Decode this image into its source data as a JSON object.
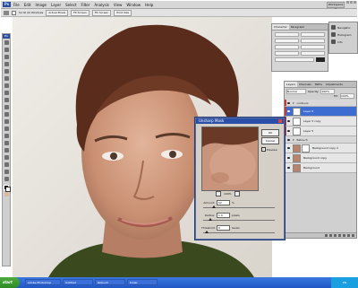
{
  "menubar": {
    "app": "Ps",
    "items": [
      "File",
      "Edit",
      "Image",
      "Layer",
      "Select",
      "Filter",
      "Analysis",
      "View",
      "Window",
      "Help"
    ],
    "workspace": "Workspace ▾"
  },
  "options": {
    "scroll_all": "Scroll All Windows",
    "actual_pixels": "Actual Pixels",
    "fit_screen": "Fit Screen",
    "fill_screen": "Fill Screen",
    "print_size": "Print Size"
  },
  "toolbox": {
    "header": "Ps"
  },
  "character_panel": {
    "tabs": [
      "Character",
      "Paragraph"
    ]
  },
  "nav_panel": {
    "items": [
      "Navigator",
      "Histogram",
      "Info"
    ]
  },
  "layers_panel": {
    "tabs": [
      "Layers",
      "Channels",
      "Paths",
      "Adjustments"
    ],
    "blend_mode": "Normal",
    "opacity_label": "Opacity:",
    "opacity": "100%",
    "fill_label": "Fill:",
    "fill": "100%",
    "layers": [
      {
        "name": "contours",
        "kind": "group"
      },
      {
        "name": "Layer 6",
        "kind": "layer",
        "selected": true
      },
      {
        "name": "Layer 5 copy",
        "kind": "layer"
      },
      {
        "name": "Layer 5",
        "kind": "layer"
      },
      {
        "name": "Retouch",
        "kind": "group"
      },
      {
        "name": "Background copy 2",
        "kind": "layer"
      },
      {
        "name": "Background copy",
        "kind": "layer"
      },
      {
        "name": "Background",
        "kind": "layer"
      }
    ]
  },
  "dialog": {
    "title": "Unsharp Mask",
    "ok": "OK",
    "cancel": "Cancel",
    "preview": "Preview",
    "zoom": "100%",
    "amount_label": "Amount:",
    "amount": "62",
    "amount_unit": "%",
    "radius_label": "Radius:",
    "radius": "1.0",
    "radius_unit": "pixels",
    "threshold_label": "Threshold:",
    "threshold": "6",
    "threshold_unit": "levels"
  },
  "taskbar": {
    "start": "start",
    "tasks": [
      "Adobe Photoshop",
      "Untitled",
      "Retouch",
      "folder"
    ],
    "clock": "EN"
  },
  "colors": {
    "ps_blue": "#2b4d9b",
    "selected_layer": "#3d6dd1",
    "taskbar_blue": "#1f57c4",
    "start_green": "#2f8a24"
  }
}
